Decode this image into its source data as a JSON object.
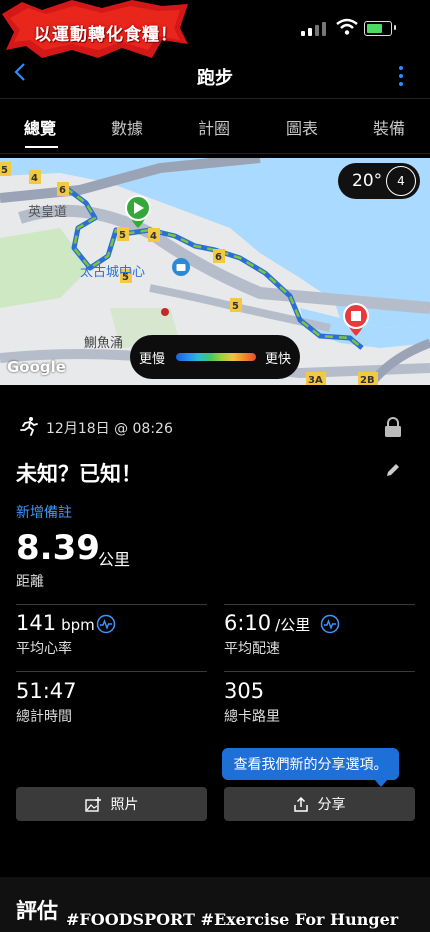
{
  "banner": {
    "text": "以運動轉化食糧！"
  },
  "nav": {
    "title": "跑步"
  },
  "tabs": [
    "總覽",
    "數據",
    "計圈",
    "圖表",
    "裝備"
  ],
  "map": {
    "temperature": "20°",
    "wind": "4",
    "labels": {
      "road": "英皇道",
      "mall": "太古城中心",
      "district": "鰂魚涌",
      "route_5a": "5",
      "route_4": "4",
      "route_6": "6",
      "route_5b": "5",
      "route_4b": "4",
      "route_6b": "6",
      "route_5c": "5",
      "route_5d": "5",
      "exit_3a": "3A",
      "exit_2b": "2B"
    },
    "legend": {
      "slow": "更慢",
      "fast": "更快"
    },
    "attribution": "Google"
  },
  "activity": {
    "date": "12月18日 @ 08:26",
    "title": "未知？已知！",
    "add_note": "新增備註",
    "distance": {
      "value": "8.39",
      "unit": "公里",
      "label": "距離"
    },
    "heart_rate": {
      "value": "141",
      "unit": "bpm",
      "label": "平均心率"
    },
    "pace": {
      "value": "6:10",
      "unit": "/公里",
      "label": "平均配速"
    },
    "time": {
      "value": "51:47",
      "label": "總計時間"
    },
    "calories": {
      "value": "305",
      "label": "總卡路里"
    }
  },
  "tooltip": {
    "text": "查看我們新的分享選項。"
  },
  "buttons": {
    "photos": "照片",
    "share": "分享"
  },
  "section": {
    "title": "評估"
  },
  "watermark": {
    "prefix": "#FOODSPORT",
    "text": " #Exercise For Hunger"
  },
  "colors": {
    "accent": "#2f8cff",
    "route": "#4caf50",
    "share_tooltip": "#1e6fd8"
  }
}
